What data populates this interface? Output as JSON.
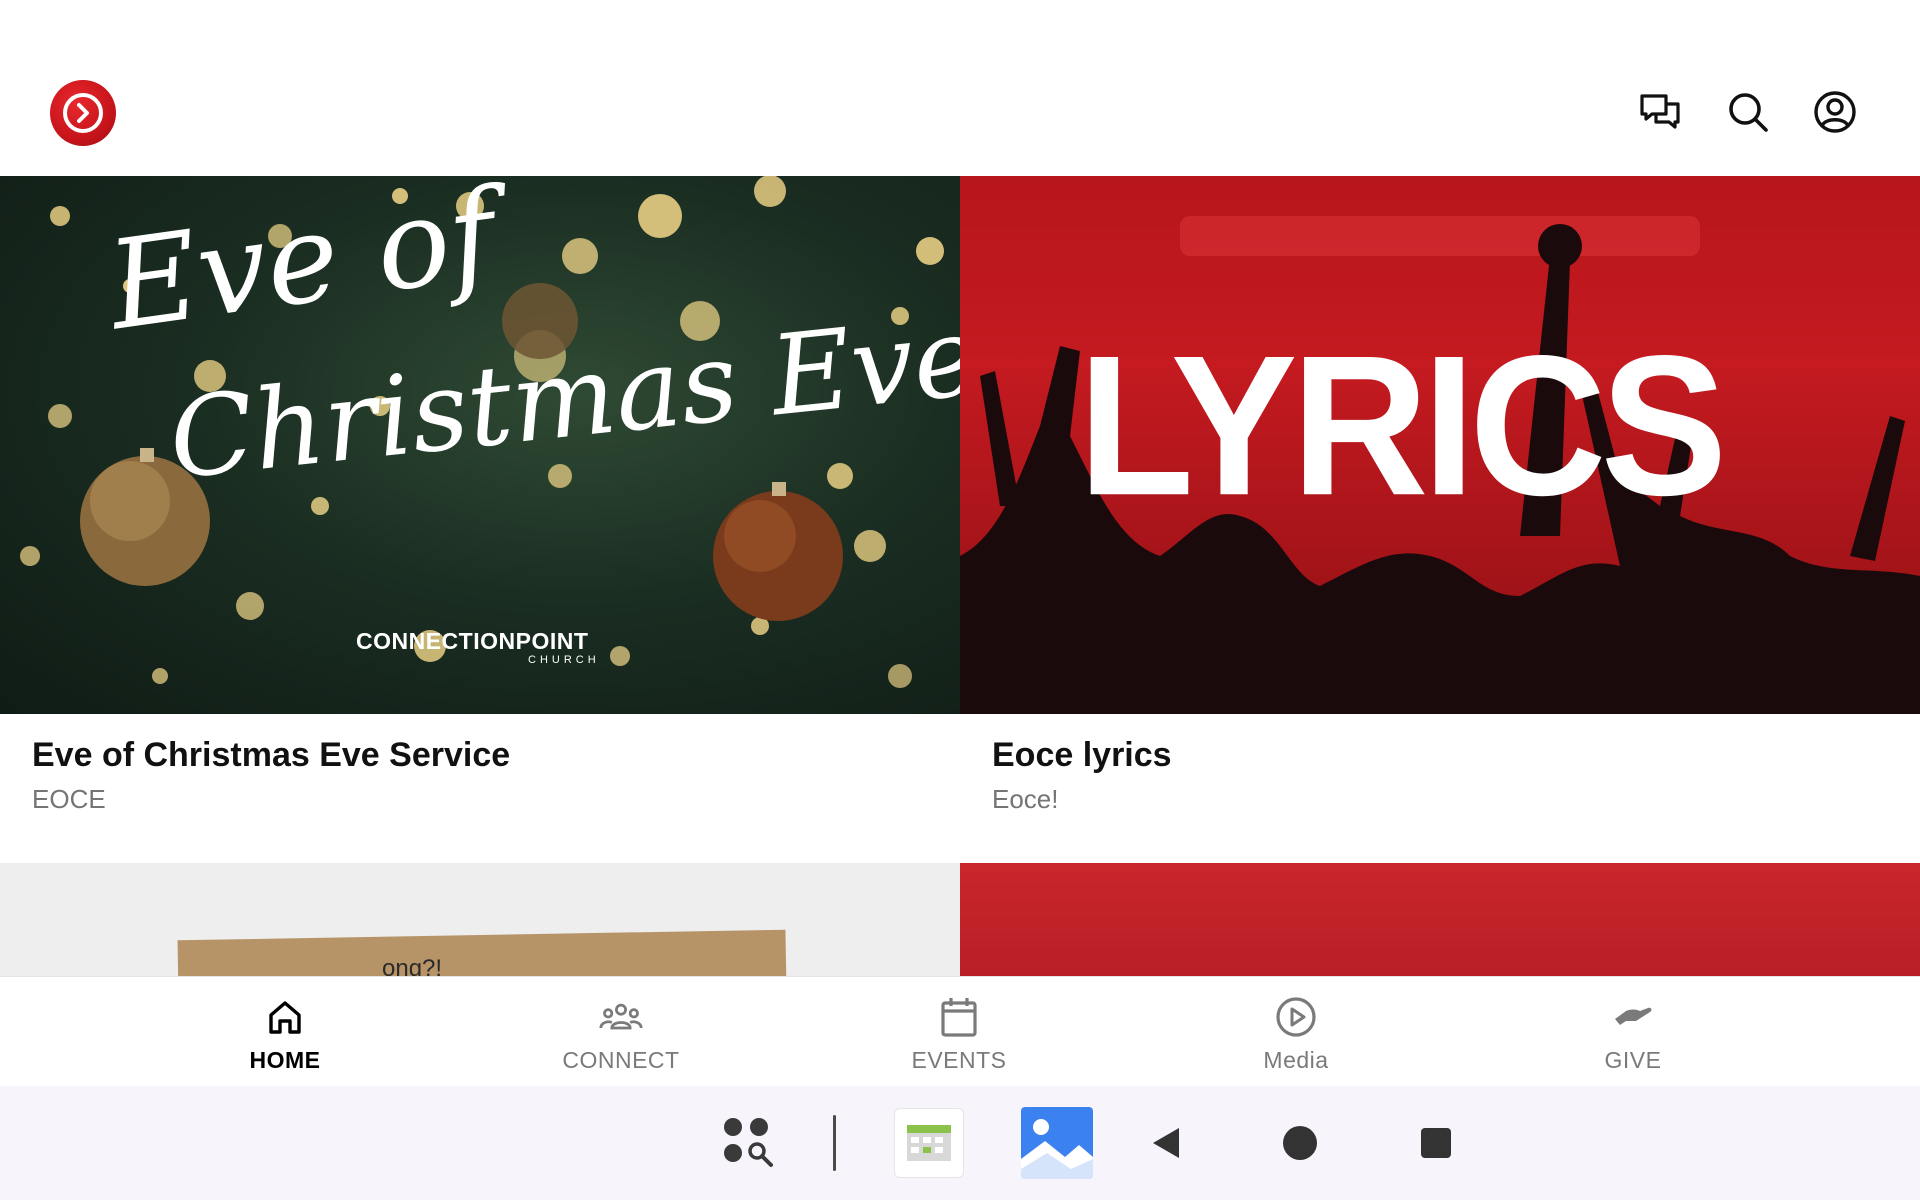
{
  "colors": {
    "brand_red": "#c8141b",
    "active_nav": "#000000",
    "inactive_nav": "#7a7a7a",
    "title": "#111111",
    "subtitle": "#757575"
  },
  "header": {
    "logo_icon": "church-logo-chevron-icon",
    "icons": [
      "chat-icon",
      "search-icon",
      "account-icon"
    ]
  },
  "cards": [
    {
      "title": "Eve of Christmas Eve Service",
      "subtitle": "EOCE",
      "image": {
        "script_line1": "Eve of",
        "script_line2": "Christmas Eve",
        "brand": "CONNECTIONPOINT",
        "brand_sub": "CHURCH"
      }
    },
    {
      "title": "Eoce lyrics",
      "subtitle": "Eoce!",
      "image": {
        "headline": "LYRICS"
      }
    }
  ],
  "row2": {
    "left_image_text": "ong?!"
  },
  "bottom_nav": [
    {
      "label": "HOME",
      "icon": "home-icon",
      "active": true
    },
    {
      "label": "CONNECT",
      "icon": "people-icon",
      "active": false
    },
    {
      "label": "EVENTS",
      "icon": "calendar-icon",
      "active": false
    },
    {
      "label": "Media",
      "icon": "play-circle-icon",
      "active": false
    },
    {
      "label": "GIVE",
      "icon": "give-hand-icon",
      "active": false
    }
  ],
  "system_bar": {
    "items": [
      "app-drawer-search-icon",
      "calendar-app-icon",
      "gallery-app-icon",
      "back-icon",
      "home-circle-icon",
      "recents-square-icon"
    ]
  }
}
